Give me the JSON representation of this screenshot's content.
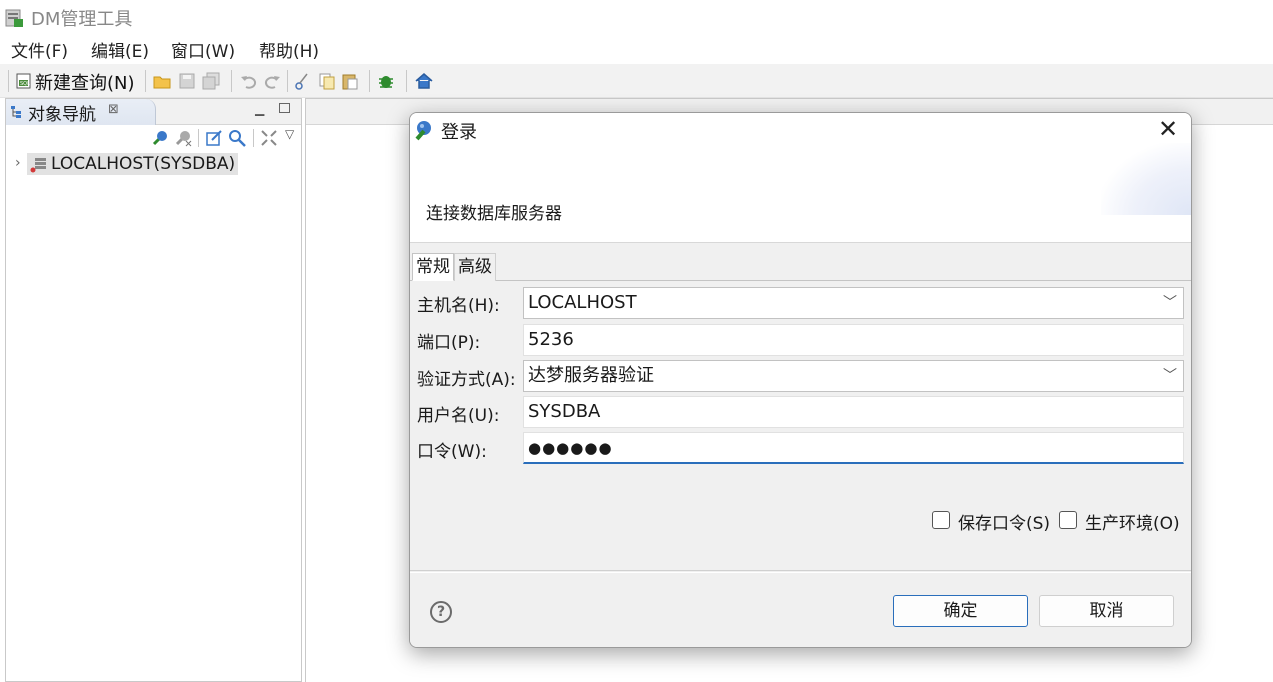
{
  "window": {
    "title": "DM管理工具",
    "icon": "app-grid-icon"
  },
  "menubar": {
    "items": [
      "文件(F)",
      "编辑(E)",
      "窗口(W)",
      "帮助(H)"
    ]
  },
  "toolbar": {
    "new_query_label": "新建查询(N)",
    "icons": [
      "new-query-icon",
      "open-folder-icon",
      "save-icon",
      "save-all-icon",
      "undo-icon",
      "redo-icon",
      "cut-icon",
      "copy-icon",
      "paste-icon",
      "debug-bug-icon",
      "home-icon"
    ]
  },
  "navigator": {
    "tab_label": "对象导航",
    "tree": [
      {
        "label": "LOCALHOST(SYSDBA)",
        "icon": "database-server-icon"
      }
    ]
  },
  "dialog": {
    "title": "登录",
    "subtitle": "连接数据库服务器",
    "tabs": [
      "常规",
      "高级"
    ],
    "fields": {
      "host": {
        "label": "主机名(H):",
        "value": "LOCALHOST"
      },
      "port": {
        "label": "端口(P):",
        "value": "5236"
      },
      "auth": {
        "label": "验证方式(A):",
        "value": "达梦服务器验证"
      },
      "user": {
        "label": "用户名(U):",
        "value": "SYSDBA"
      },
      "password": {
        "label": "口令(W):",
        "value": "●●●●●●"
      }
    },
    "checkboxes": {
      "save_password": {
        "label": "保存口令(S)",
        "checked": false
      },
      "production_env": {
        "label": "生产环境(O)",
        "checked": false
      }
    },
    "buttons": {
      "ok": "确定",
      "cancel": "取消"
    },
    "colors": {
      "accent": "#2a6ebb"
    }
  }
}
